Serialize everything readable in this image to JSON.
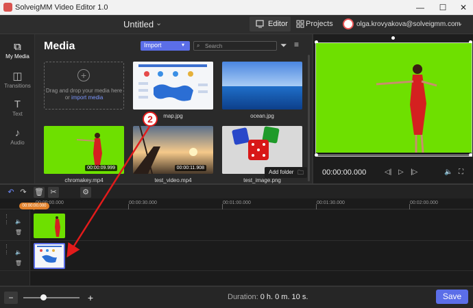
{
  "window": {
    "title": "SolveigMM Video Editor 1.0"
  },
  "header": {
    "project_title": "Untitled",
    "tabs": [
      {
        "label": "Editor"
      },
      {
        "label": "Projects"
      }
    ],
    "user_email": "olga.krovyakova@solveigmm.com"
  },
  "sidebar": {
    "items": [
      {
        "label": "My Media"
      },
      {
        "label": "Transitions"
      },
      {
        "label": "Text"
      },
      {
        "label": "Audio"
      }
    ]
  },
  "media": {
    "title": "Media",
    "import_label": "Import",
    "search_placeholder": "Search",
    "drop_text": "Drag and drop your media here or",
    "drop_link": "import media",
    "add_folder_label": "Add folder",
    "items": [
      {
        "name": "map.jpg",
        "duration": ""
      },
      {
        "name": "ocean.jpg",
        "duration": ""
      },
      {
        "name": "chromakey.mp4",
        "duration": "00:00:09.999"
      },
      {
        "name": "test_video.mp4",
        "duration": "00:00:11.908"
      },
      {
        "name": "test_image.png",
        "duration": ""
      }
    ]
  },
  "preview": {
    "time": "00:00:00.000"
  },
  "timeline": {
    "playhead_time": "00:00:00.000",
    "ruler_labels": [
      "00:00:00.000",
      "00:00:30.000",
      "00:01:00.000",
      "00:01:30.000",
      "00:02:00.000"
    ]
  },
  "footer": {
    "duration_label": "Duration:",
    "duration_value": "0 h. 0 m. 10 s.",
    "save_label": "Save"
  },
  "annotation": {
    "marker_number": "2"
  },
  "colors": {
    "accent": "#5b6ee8",
    "playhead": "#e0802a",
    "chroma_green": "#6ee000",
    "annotation_red": "#e21b1b"
  }
}
